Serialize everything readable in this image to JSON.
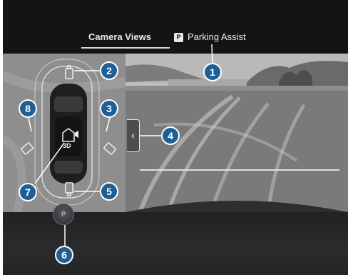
{
  "tabs": {
    "camera_views": "Camera Views",
    "parking_assist": "Parking Assist",
    "parking_badge": "P"
  },
  "view_3d_label": "3D",
  "parking_button_label": "P",
  "side_arrow_glyph": "‹",
  "callouts": {
    "c1": "1",
    "c2": "2",
    "c3": "3",
    "c4": "4",
    "c5": "5",
    "c6": "6",
    "c7": "7",
    "c8": "8"
  },
  "colors": {
    "callout": "#1f5f95",
    "background": "#1b1b1d",
    "tab_text": "#e9e9e9"
  },
  "icons": [
    "front-camera-icon",
    "left-mirror-camera-icon",
    "right-mirror-camera-icon",
    "rear-camera-icon",
    "3d-view-icon",
    "parking-button-icon",
    "chevron-left-icon"
  ]
}
